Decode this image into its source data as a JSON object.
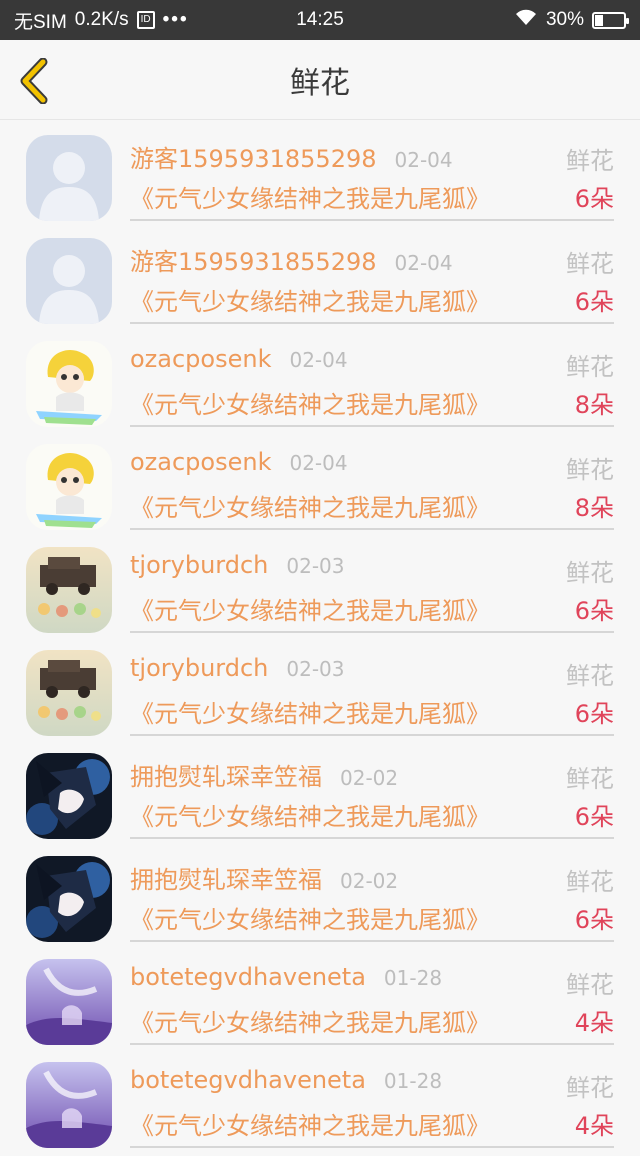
{
  "status": {
    "carrier": "无SIM",
    "speed": "0.2K/s",
    "sim_icon_text": "ID",
    "more": "•••",
    "time": "14:25",
    "battery": "30%",
    "battery_level": 0.3
  },
  "header": {
    "title": "鲜花"
  },
  "colors": {
    "name": "#ee9a5a",
    "count": "#e0445a",
    "back_icon": "#f2c200"
  },
  "items": [
    {
      "name": "游客1595931855298",
      "date": "02-04",
      "type": "鲜花",
      "book": "《元气少女缘结神之我是九尾狐》",
      "count": "6朵",
      "avatar": "default-avatar"
    },
    {
      "name": "游客1595931855298",
      "date": "02-04",
      "type": "鲜花",
      "book": "《元气少女缘结神之我是九尾狐》",
      "count": "6朵",
      "avatar": "default-avatar"
    },
    {
      "name": "ozacposenk",
      "date": "02-04",
      "type": "鲜花",
      "book": "《元气少女缘结神之我是九尾狐》",
      "count": "8朵",
      "avatar": "cartoon-avatar"
    },
    {
      "name": "ozacposenk",
      "date": "02-04",
      "type": "鲜花",
      "book": "《元气少女缘结神之我是九尾狐》",
      "count": "8朵",
      "avatar": "cartoon-avatar"
    },
    {
      "name": "tjoryburdch",
      "date": "02-03",
      "type": "鲜花",
      "book": "《元气少女缘结神之我是九尾狐》",
      "count": "6朵",
      "avatar": "car-avatar"
    },
    {
      "name": "tjoryburdch",
      "date": "02-03",
      "type": "鲜花",
      "book": "《元气少女缘结神之我是九尾狐》",
      "count": "6朵",
      "avatar": "car-avatar"
    },
    {
      "name": "拥抱熨轧琛幸笠福",
      "date": "02-02",
      "type": "鲜花",
      "book": "《元气少女缘结神之我是九尾狐》",
      "count": "6朵",
      "avatar": "anime-avatar"
    },
    {
      "name": "拥抱熨轧琛幸笠福",
      "date": "02-02",
      "type": "鲜花",
      "book": "《元气少女缘结神之我是九尾狐》",
      "count": "6朵",
      "avatar": "anime-avatar"
    },
    {
      "name": "botetegvdhaveneta",
      "date": "01-28",
      "type": "鲜花",
      "book": "《元气少女缘结神之我是九尾狐》",
      "count": "4朵",
      "avatar": "purple-avatar"
    },
    {
      "name": "botetegvdhaveneta",
      "date": "01-28",
      "type": "鲜花",
      "book": "《元气少女缘结神之我是九尾狐》",
      "count": "4朵",
      "avatar": "purple-avatar"
    }
  ]
}
